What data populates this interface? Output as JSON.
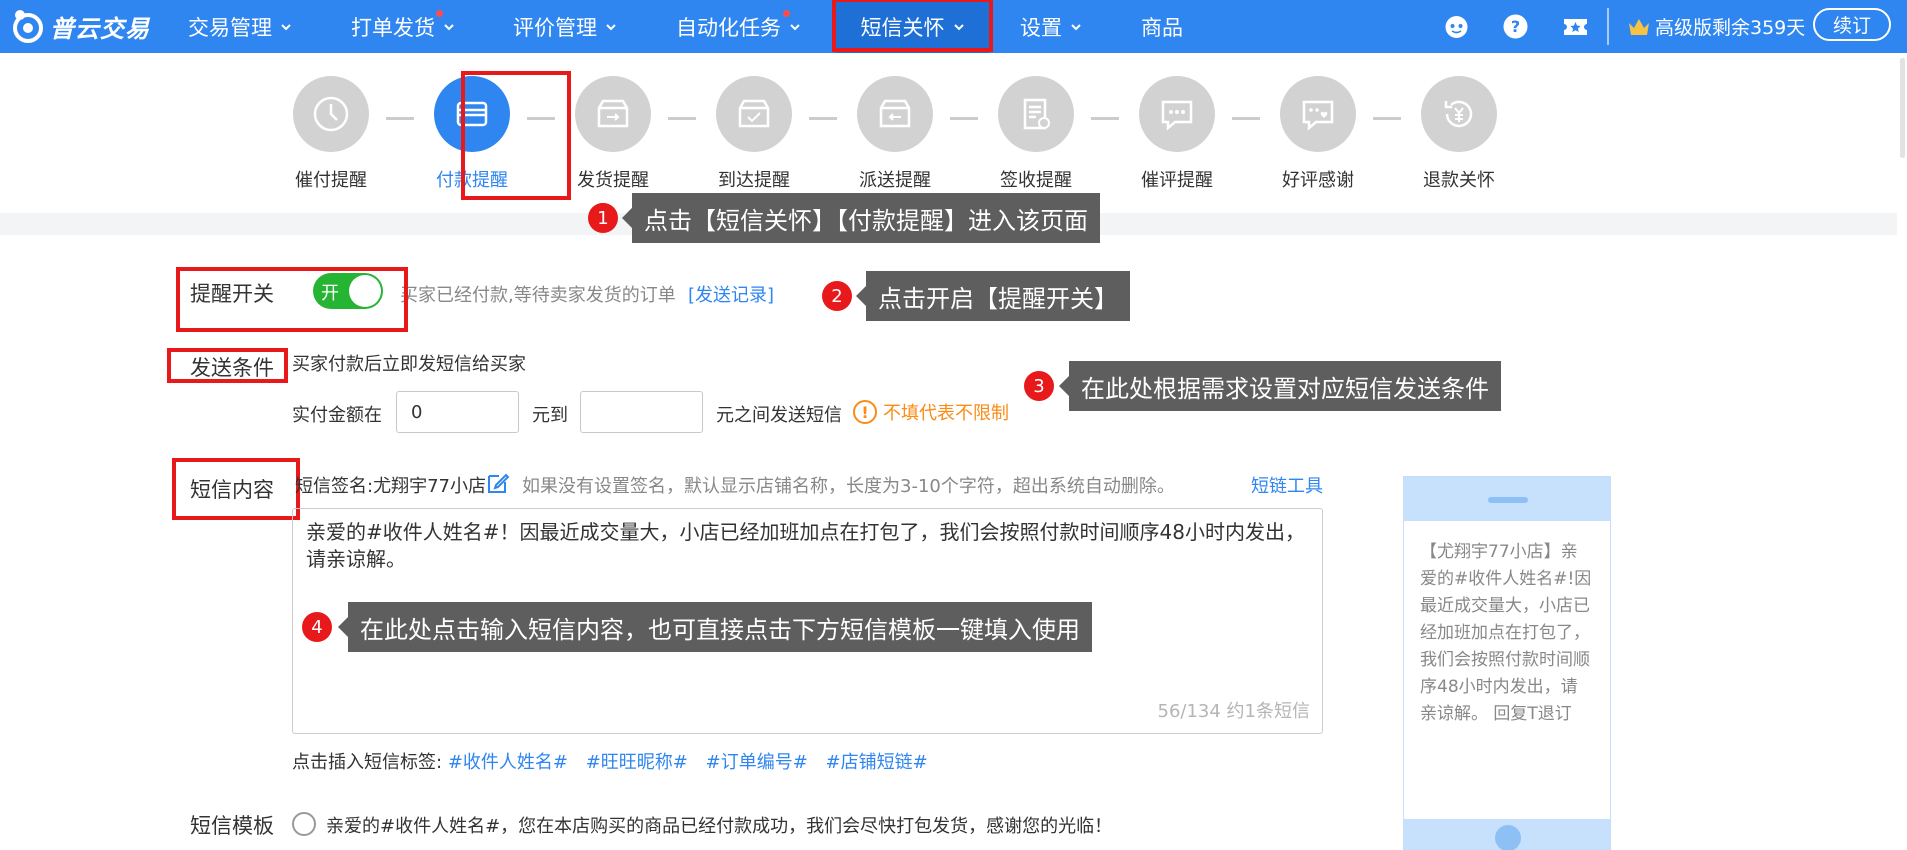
{
  "brand": {
    "name": "普云交易"
  },
  "nav": {
    "items": [
      {
        "label": "交易管理",
        "has_menu": true
      },
      {
        "label": "打单发货",
        "has_menu": true,
        "dot": true
      },
      {
        "label": "评价管理",
        "has_menu": true
      },
      {
        "label": "自动化任务",
        "has_menu": true,
        "dot": true
      },
      {
        "label": "短信关怀",
        "has_menu": true,
        "active": true
      },
      {
        "label": "设置",
        "has_menu": true
      },
      {
        "label": "商品",
        "has_menu": false
      }
    ],
    "icons": [
      "robot-icon",
      "help-icon",
      "ticket-icon"
    ],
    "vip_text": "高级版剩余359天",
    "renew_label": "续订"
  },
  "steps": [
    {
      "label": "催付提醒",
      "icon": "clock-icon"
    },
    {
      "label": "付款提醒",
      "icon": "card-icon",
      "active": true
    },
    {
      "label": "发货提醒",
      "icon": "ship-box-icon"
    },
    {
      "label": "到达提醒",
      "icon": "arrive-box-icon"
    },
    {
      "label": "派送提醒",
      "icon": "deliver-box-icon"
    },
    {
      "label": "签收提醒",
      "icon": "sign-doc-icon"
    },
    {
      "label": "催评提醒",
      "icon": "chat-icon"
    },
    {
      "label": "好评感谢",
      "icon": "heart-chat-icon"
    },
    {
      "label": "退款关怀",
      "icon": "refund-icon"
    }
  ],
  "callouts": [
    {
      "num": "1",
      "text": "点击【短信关怀】【付款提醒】进入该页面"
    },
    {
      "num": "2",
      "text": "点击开启【提醒开关】"
    },
    {
      "num": "3",
      "text": "在此处根据需求设置对应短信发送条件"
    },
    {
      "num": "4",
      "text": "在此处点击输入短信内容，也可直接点击下方短信模板一键填入使用"
    }
  ],
  "form": {
    "switch_label": "提醒开关",
    "switch_state": "开",
    "switch_desc": "买家已经付款,等待卖家发货的订单",
    "send_log_link": "[发送记录]",
    "condition_label": "发送条件",
    "condition_desc": "买家付款后立即发短信给买家",
    "amount_prefix": "实付金额在",
    "amount_min": "0",
    "amount_mid": "元到",
    "amount_max": "",
    "amount_suffix": "元之间发送短信",
    "amount_hint": "不填代表不限制",
    "content_label": "短信内容",
    "signature": "短信签名:尤翔宇77小店",
    "signature_hint": "如果没有设置签名，默认显示店铺名称，长度为3-10个字符，超出系统自动删除。",
    "short_link_tool": "短链工具",
    "sms_text": "亲爱的#收件人姓名#！因最近成交量大，小店已经加班加点在打包了，我们会按照付款时间顺序48小时内发出，请亲谅解。",
    "counter": "56/134  约1条短信",
    "insert_tags_label": "点击插入短信标签:",
    "insert_tags": [
      "#收件人姓名#",
      "#旺旺昵称#",
      "#订单编号#",
      "#店铺短链#"
    ],
    "template_label": "短信模板",
    "template_option": "亲爱的#收件人姓名#，您在本店购买的商品已经付款成功，我们会尽快打包发货，感谢您的光临！"
  },
  "preview": {
    "text": "【尤翔宇77小店】亲爱的#收件人姓名#!因最近成交量大，小店已经加班加点在打包了，我们会按照付款时间顺序48小时内发出，请亲谅解。 回复T退订"
  },
  "colors": {
    "primary": "#2f86f0",
    "highlight": "#e8191b",
    "toggle_on": "#26b533",
    "warn": "#fa8c16"
  }
}
